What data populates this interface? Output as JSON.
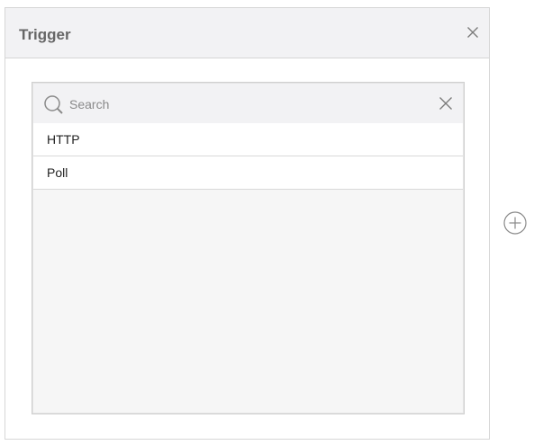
{
  "dialog": {
    "title": "Trigger",
    "close_icon": "close-icon"
  },
  "search": {
    "placeholder": "Search",
    "value": "",
    "search_icon": "search-icon",
    "clear_icon": "clear-icon"
  },
  "options": [
    {
      "label": "HTTP"
    },
    {
      "label": "Poll"
    }
  ],
  "add_button": {
    "icon": "plus-circle-icon"
  }
}
